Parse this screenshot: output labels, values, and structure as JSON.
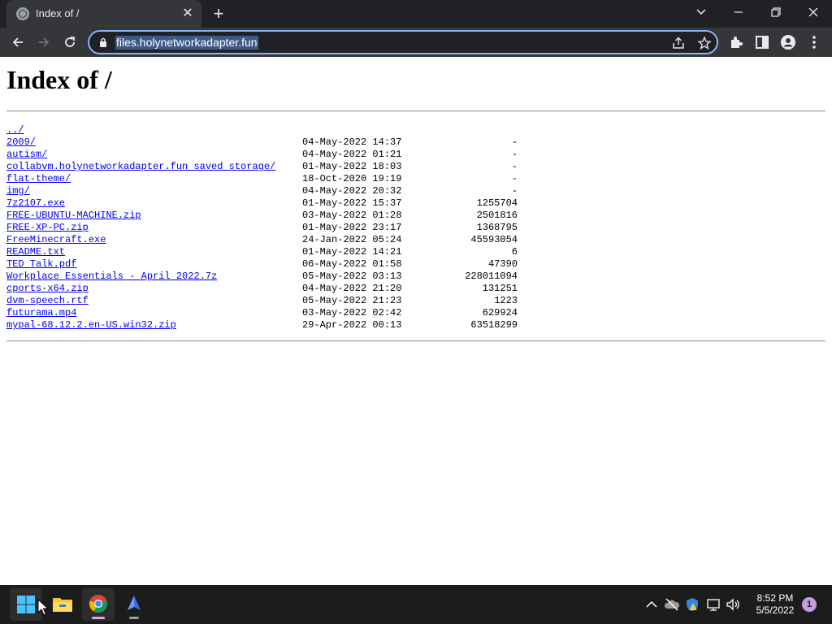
{
  "browser": {
    "tab_title": "Index of /",
    "url": "files.holynetworkadapter.fun"
  },
  "page": {
    "title": "Index of /",
    "entries": [
      {
        "name": "../",
        "date": "",
        "size": ""
      },
      {
        "name": "2009/",
        "date": "04-May-2022 14:37",
        "size": "-"
      },
      {
        "name": "autism/",
        "date": "04-May-2022 01:21",
        "size": "-"
      },
      {
        "name": "collabvm.holynetworkadapter.fun saved storage/",
        "date": "01-May-2022 18:03",
        "size": "-"
      },
      {
        "name": "flat-theme/",
        "date": "18-Oct-2020 19:19",
        "size": "-"
      },
      {
        "name": "img/",
        "date": "04-May-2022 20:32",
        "size": "-"
      },
      {
        "name": "7z2107.exe",
        "date": "01-May-2022 15:37",
        "size": "1255704"
      },
      {
        "name": "FREE-UBUNTU-MACHINE.zip",
        "date": "03-May-2022 01:28",
        "size": "2501816"
      },
      {
        "name": "FREE-XP-PC.zip",
        "date": "01-May-2022 23:17",
        "size": "1368795"
      },
      {
        "name": "FreeMinecraft.exe",
        "date": "24-Jan-2022 05:24",
        "size": "45593054"
      },
      {
        "name": "README.txt",
        "date": "01-May-2022 14:21",
        "size": "6"
      },
      {
        "name": "TED Talk.pdf",
        "date": "06-May-2022 01:58",
        "size": "47390"
      },
      {
        "name": "Workplace Essentials - April 2022.7z",
        "date": "05-May-2022 03:13",
        "size": "228011094"
      },
      {
        "name": "cports-x64.zip",
        "date": "04-May-2022 21:20",
        "size": "131251"
      },
      {
        "name": "dvm-speech.rtf",
        "date": "05-May-2022 21:23",
        "size": "1223"
      },
      {
        "name": "futurama.mp4",
        "date": "03-May-2022 02:42",
        "size": "629924"
      },
      {
        "name": "mypal-68.12.2.en-US.win32.zip",
        "date": "29-Apr-2022 00:13",
        "size": "63518299"
      }
    ]
  },
  "taskbar": {
    "time": "8:52 PM",
    "date": "5/5/2022",
    "notification_count": "1",
    "apps": [
      "start-icon",
      "file-explorer-icon",
      "chrome-icon",
      "app-icon"
    ]
  },
  "colors": {
    "link": "#0000ee",
    "chrome_dark": "#202124",
    "chrome_toolbar": "#35363a",
    "omnibox_focus": "#8ab4f8",
    "taskbar": "#1c1c1c"
  }
}
